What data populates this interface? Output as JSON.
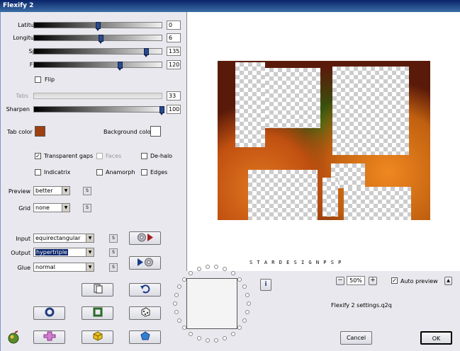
{
  "window": {
    "title": "Flexify 2"
  },
  "sliders": [
    {
      "label": "Latitude",
      "value": "0",
      "level": 0.5
    },
    {
      "label": "Longitude",
      "value": "6",
      "level": 0.52
    },
    {
      "label": "Spin",
      "value": "135",
      "level": 0.88
    },
    {
      "label": "FOV",
      "value": "120",
      "level": 0.67
    }
  ],
  "flip": {
    "label": "Flip",
    "checked": false
  },
  "tabs": {
    "label": "Tabs",
    "value": "33",
    "disabled": true
  },
  "sharpen": {
    "label": "Sharpen",
    "value": "100",
    "level": 1.0
  },
  "colors": {
    "tab_label": "Tab color",
    "tab_color": "#a04010",
    "bg_label": "Background color",
    "bg_color": "#ffffff"
  },
  "checks": {
    "transparent_gaps": {
      "label": "Transparent gaps",
      "mark": "✓"
    },
    "faces": {
      "label": "Faces",
      "mark": ""
    },
    "dehalo": {
      "label": "De-halo",
      "mark": ""
    },
    "indicatrix": {
      "label": "Indicatrix",
      "mark": ""
    },
    "anamorph": {
      "label": "Anamorph",
      "mark": ""
    },
    "edges": {
      "label": "Edges",
      "mark": ""
    }
  },
  "preview_opt": {
    "label": "Preview",
    "value": "better",
    "s": "S"
  },
  "grid_opt": {
    "label": "Grid",
    "value": "none",
    "s": "S"
  },
  "input_opt": {
    "label": "Input",
    "value": "equirectangular",
    "s": "S"
  },
  "output_opt": {
    "label": "Output",
    "value": "hypertriple",
    "s": "S"
  },
  "glue_opt": {
    "label": "Glue",
    "value": "normal",
    "s": "S"
  },
  "watermark": "S T A R D E S I G N P S P",
  "zoom": {
    "minus": "−",
    "value": "50%",
    "plus": "+"
  },
  "auto_preview": {
    "label": "Auto preview",
    "mark": "✓",
    "arrow": "▲"
  },
  "info": {
    "glyph": "i"
  },
  "settings_file": "Flexify 2 settings.q2q",
  "cancel": "Cancel",
  "ok": "OK"
}
